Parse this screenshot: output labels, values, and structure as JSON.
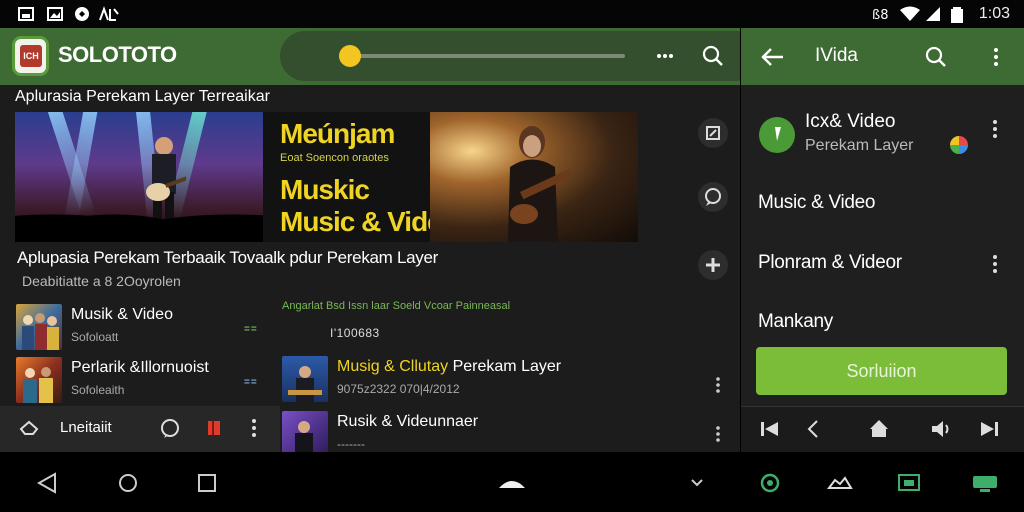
{
  "status_bar": {
    "left_icons": [
      "picture-icon",
      "image-icon",
      "shield-icon",
      "notification-icon"
    ],
    "right_icons": [
      "nfc-icon",
      "wifi-icon",
      "signal-icon",
      "battery-icon"
    ],
    "time": "1:03"
  },
  "main": {
    "app_title": "SOLOTOTO",
    "logo_text": "ICH",
    "slider": {
      "value": 0.0
    },
    "section_heading": "Aplurasia Perekam Layer  Terreaikar",
    "hero": {
      "line1": "Meúnjam",
      "line2": "Eoat Soencon   oraotes",
      "line3": "Muskic",
      "line4": "Music & Video"
    },
    "subheading": "Aplupasia Perekam Terbaaik Tovaalk pdur  Perekam Layer",
    "subcaption": "Deabitiatte a 8 2Ooyrolen",
    "list_left": [
      {
        "title": "Musik & Video",
        "subtitle": "Sofoloatt",
        "badge": "=="
      },
      {
        "title": "Perlarik &Illornuoist",
        "subtitle": "Sofoleaith",
        "badge": "=="
      }
    ],
    "mid_caption": "Angarlat Bsd   Issn laar  Soeld Vcoar  Painneasal",
    "mid_number": "I'100683",
    "list_mid": [
      {
        "title_accent": "Musig & Cllutay",
        "title": "Perekam Layer",
        "subtitle": "9075z2322  070|4/2012"
      },
      {
        "title": "Rusik & Videunnaer",
        "subtitle": "-------"
      }
    ],
    "bottom_label": "Lneitaiit"
  },
  "right": {
    "title": "IVida",
    "card_title": "Icx& Video",
    "card_subtitle": "Perekam Layer",
    "items": [
      "Music & Video",
      "Plonram & Videor",
      "Mankany"
    ],
    "button_label": "Sorluiion"
  },
  "colors": {
    "header_green": "#3e6a33",
    "accent_yellow": "#efd423",
    "button_green": "#7bbd38",
    "background": "#1b1c1b"
  }
}
